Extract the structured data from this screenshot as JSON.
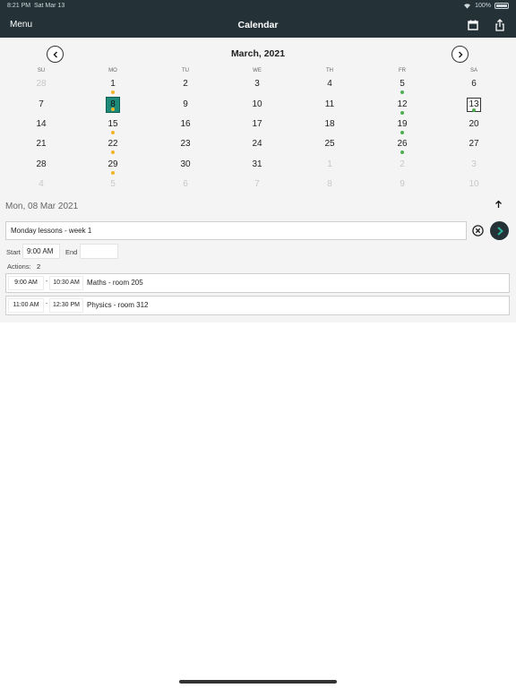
{
  "status_bar": {
    "time": "8:21 PM",
    "date": "Sat Mar 13",
    "battery": "100%"
  },
  "nav": {
    "menu_label": "Menu",
    "title": "Calendar",
    "calendar_icon": "calendar-icon",
    "share_icon": "share-icon"
  },
  "calendar": {
    "month_title": "March, 2021",
    "weekdays": [
      "SU",
      "MO",
      "TU",
      "WE",
      "TH",
      "FR",
      "SA"
    ],
    "weeks": [
      [
        "28",
        "1",
        "2",
        "3",
        "4",
        "5",
        "6"
      ],
      [
        "7",
        "8",
        "9",
        "10",
        "11",
        "12",
        "13"
      ],
      [
        "14",
        "15",
        "16",
        "17",
        "18",
        "19",
        "20"
      ],
      [
        "21",
        "22",
        "23",
        "24",
        "25",
        "26",
        "27"
      ],
      [
        "28",
        "29",
        "30",
        "31",
        "1",
        "2",
        "3"
      ],
      [
        "4",
        "5",
        "6",
        "7",
        "8",
        "9",
        "10"
      ]
    ],
    "other_month_cells": [
      [
        0,
        0
      ],
      [
        4,
        4
      ],
      [
        4,
        5
      ],
      [
        4,
        6
      ],
      [
        5,
        0
      ],
      [
        5,
        1
      ],
      [
        5,
        2
      ],
      [
        5,
        3
      ],
      [
        5,
        4
      ],
      [
        5,
        5
      ],
      [
        5,
        6
      ]
    ],
    "selected_cell": [
      1,
      1
    ],
    "today_cell": [
      1,
      6
    ],
    "dot_colors": {
      "orange": "#f0b429",
      "green": "#4caf50"
    },
    "dots": [
      {
        "cell": [
          0,
          1
        ],
        "color": "orange"
      },
      {
        "cell": [
          0,
          5
        ],
        "color": "green"
      },
      {
        "cell": [
          1,
          1
        ],
        "color": "orange"
      },
      {
        "cell": [
          1,
          5
        ],
        "color": "green"
      },
      {
        "cell": [
          1,
          6
        ],
        "color": "green"
      },
      {
        "cell": [
          2,
          1
        ],
        "color": "orange"
      },
      {
        "cell": [
          2,
          5
        ],
        "color": "green"
      },
      {
        "cell": [
          3,
          1
        ],
        "color": "orange"
      },
      {
        "cell": [
          3,
          5
        ],
        "color": "green"
      },
      {
        "cell": [
          4,
          1
        ],
        "color": "orange"
      }
    ]
  },
  "detail": {
    "date_heading": "Mon, 08 Mar 2021",
    "note_value": "Monday lessons - week 1",
    "start_label": "Start",
    "start_value": "9:00 AM",
    "end_label": "End",
    "end_value": "",
    "actions_label": "Actions:",
    "actions_count": "2",
    "actions": [
      {
        "start": "9:00 AM",
        "end": "10:30 AM",
        "description": "Maths - room 205"
      },
      {
        "start": "11:00 AM",
        "end": "12:30 PM",
        "description": "Physics - room 312"
      }
    ]
  },
  "colors": {
    "header_bg": "#243238",
    "selected_day_bg": "#1e8a7a",
    "panel_bg": "#f4f4f4"
  }
}
